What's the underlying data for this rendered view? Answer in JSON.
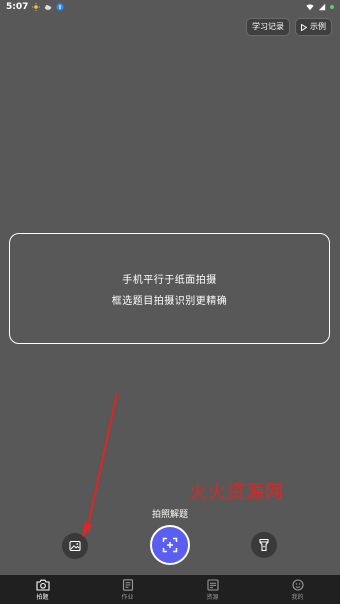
{
  "status_bar": {
    "time": "5:07",
    "battery_color": "#58d15b"
  },
  "top_actions": {
    "history_label": "学习记录",
    "example_label": "示例"
  },
  "frame": {
    "line1": "手机平行于纸面拍摄",
    "line2": "框选题目拍摄识别更精确"
  },
  "watermark": "火火资源网",
  "shoot": {
    "label": "拍照解题",
    "accent_color": "#5a5ff0"
  },
  "arrow_color": "#e12424",
  "bottom_nav": {
    "items": [
      {
        "label": "拍题",
        "icon": "camera-icon",
        "active": true
      },
      {
        "label": "作业",
        "icon": "homework-icon",
        "active": false
      },
      {
        "label": "资源",
        "icon": "resource-icon",
        "active": false
      },
      {
        "label": "我的",
        "icon": "profile-icon",
        "active": false
      }
    ]
  }
}
